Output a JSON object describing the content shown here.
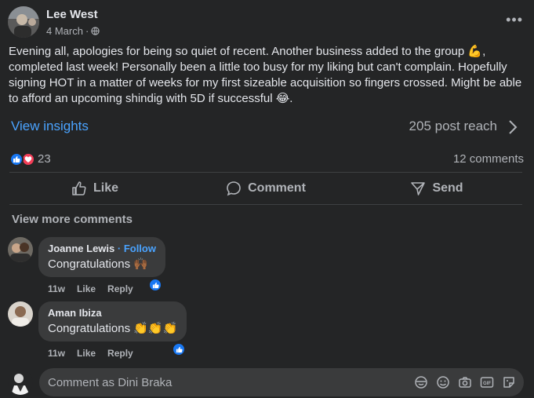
{
  "post": {
    "author": "Lee West",
    "date": "4 March",
    "separator": "·",
    "text": "Evening all, apologies for being so quiet of recent. Another business added to the group 💪, completed last week! Personally been a little too busy for my liking but can't complain. Hopefully signing HOT in a matter of weeks for my first sizeable acquisition so fingers crossed. Might be able to afford an upcoming shindig with 5D if successful 😂."
  },
  "insights": {
    "link": "View insights",
    "reach": "205 post reach"
  },
  "reactions": {
    "count": "23",
    "comments": "12 comments"
  },
  "actions": {
    "like": "Like",
    "comment": "Comment",
    "send": "Send"
  },
  "comments_section": {
    "view_more": "View more comments",
    "items": [
      {
        "name": "Joanne Lewis",
        "follow": "· Follow",
        "text": "Congratulations 🙌🏾",
        "time": "11w",
        "like": "Like",
        "reply": "Reply"
      },
      {
        "name": "Aman Ibiza",
        "text": "Congratulations 👏👏👏",
        "time": "11w",
        "like": "Like",
        "reply": "Reply"
      }
    ]
  },
  "composer": {
    "placeholder": "Comment as Dini Braka"
  },
  "colors": {
    "background": "#242526",
    "link_blue": "#4aa3ff",
    "like_blue": "#1877f2",
    "love_red": "#f33e58",
    "bubble": "#3a3b3c"
  }
}
